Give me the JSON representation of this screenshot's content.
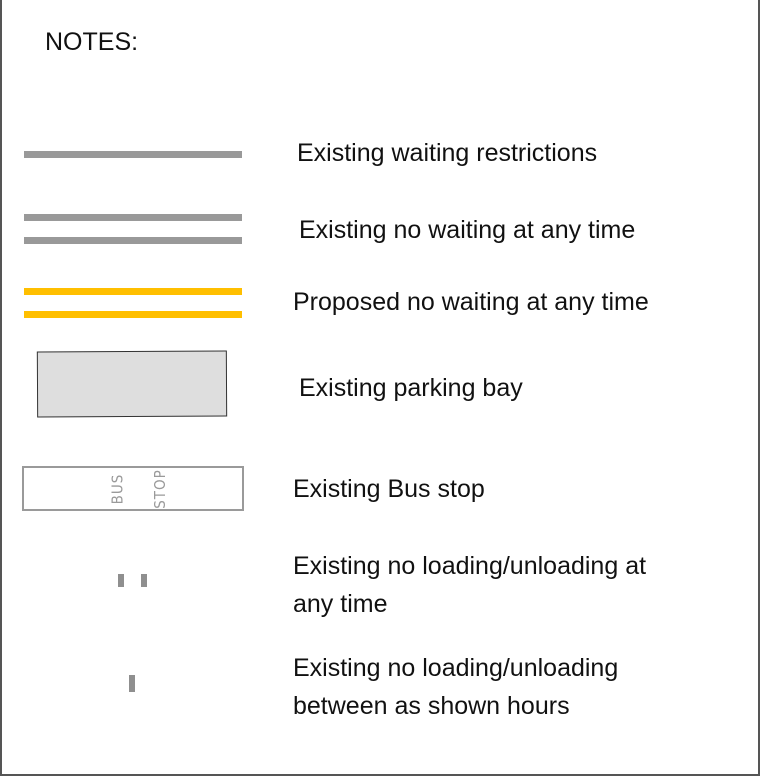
{
  "title": "NOTES:",
  "legend": [
    {
      "id": "existing-waiting",
      "label": "Existing waiting restrictions",
      "symbol": "single-grey-line",
      "color": "#999999"
    },
    {
      "id": "existing-no-waiting",
      "label": "Existing no waiting at any time",
      "symbol": "double-grey-line",
      "color": "#999999"
    },
    {
      "id": "proposed-no-waiting",
      "label": "Proposed no waiting at any time",
      "symbol": "double-yellow-line",
      "color": "#ffbf00"
    },
    {
      "id": "parking-bay",
      "label": "Existing parking bay",
      "symbol": "grey-box",
      "color": "#dedede"
    },
    {
      "id": "bus-stop",
      "label": "Existing Bus stop",
      "symbol": "bus-stop-box",
      "color": "#9a9a9a",
      "marking": [
        "BUS",
        "STOP"
      ]
    },
    {
      "id": "no-loading-any",
      "label_lines": [
        "Existing no loading/unloading at",
        "any time"
      ],
      "symbol": "double-tick",
      "color": "#8f8f8f"
    },
    {
      "id": "no-loading-hours",
      "label_lines": [
        "Existing no loading/unloading",
        "between as shown hours"
      ],
      "symbol": "single-tick",
      "color": "#8f8f8f"
    }
  ]
}
